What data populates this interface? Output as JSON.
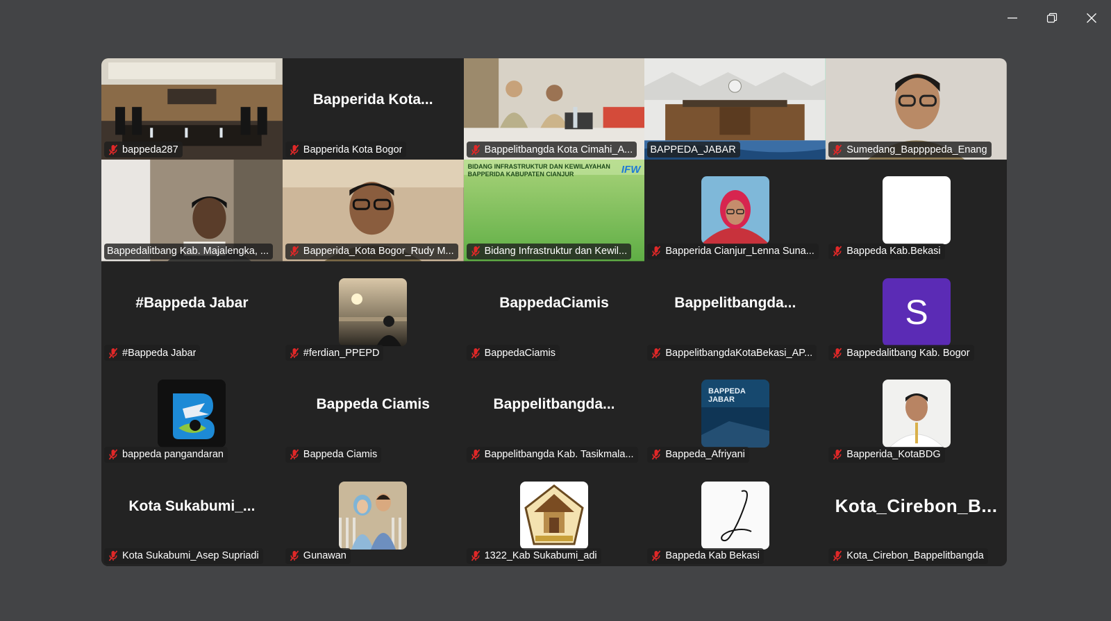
{
  "window": {
    "minimize_icon": "minimize-icon",
    "restore_icon": "restore-icon",
    "close_icon": "close-icon"
  },
  "colors": {
    "background": "#434446",
    "tile": "#232323",
    "active_border": "#23d98f",
    "muted_icon": "#e02828",
    "label_bg": "rgba(30,30,30,0.8)",
    "avatar_s": "#5b2bb5"
  },
  "participants": [
    {
      "name": "bappeda287",
      "kind": "video",
      "scene": "meeting-room"
    },
    {
      "name": "Bapperida Kota Bogor",
      "kind": "text",
      "big_name": "Bapperida  Kota..."
    },
    {
      "name": "Bappelitbangda Kota Cimahi_A...",
      "kind": "video",
      "scene": "office-desk"
    },
    {
      "name": "BAPPEDA_JABAR",
      "kind": "video",
      "scene": "stage",
      "active": true,
      "muted": false
    },
    {
      "name": "Sumedang_Bappppeda_Enang",
      "kind": "video",
      "scene": "person-glasses"
    },
    {
      "name": "Bappedalitbang Kab. Majalengka, ...",
      "kind": "video",
      "scene": "person-reading",
      "muted": false
    },
    {
      "name": "Bapperida_Kota Bogor_Rudy M...",
      "kind": "video",
      "scene": "person-glasses-2"
    },
    {
      "name": "Bidang Infrastruktur dan Kewil...",
      "kind": "video",
      "scene": "banner",
      "banner_line1": "BIDANG INFRASTRUKTUR DAN KEWILAYAHAN",
      "banner_line2": "BAPPERIDA KABUPATEN CIANJUR",
      "banner_logo": "IFW"
    },
    {
      "name": "Bapperida Cianjur_Lenna Suna...",
      "kind": "avatar",
      "avatar": "photo-hijab"
    },
    {
      "name": "Bappeda Kab.Bekasi",
      "kind": "avatar",
      "avatar": "white"
    },
    {
      "name": "#Bappeda Jabar",
      "kind": "text",
      "big_name": "#Bappeda Jabar"
    },
    {
      "name": "#ferdian_PPEPD",
      "kind": "avatar",
      "avatar": "photo-sunset"
    },
    {
      "name": "BappedaCiamis",
      "kind": "text",
      "big_name": "BappedaCiamis"
    },
    {
      "name": "BappelitbangdaKotaBekasi_AP...",
      "kind": "text",
      "big_name": "Bappelitbangda..."
    },
    {
      "name": "Bappedalitbang Kab. Bogor",
      "kind": "avatar",
      "avatar": "letter",
      "letter": "S"
    },
    {
      "name": "bappeda pangandaran",
      "kind": "avatar",
      "avatar": "logo-marlin"
    },
    {
      "name": "Bappeda Ciamis",
      "kind": "text",
      "big_name": "Bappeda Ciamis"
    },
    {
      "name": "Bappelitbangda Kab. Tasikmala...",
      "kind": "text",
      "big_name": "Bappelitbangda..."
    },
    {
      "name": "Bappeda_Afriyani",
      "kind": "avatar",
      "avatar": "book",
      "book_title": "BAPPEDA JABAR"
    },
    {
      "name": "Bapperida_KotaBDG",
      "kind": "avatar",
      "avatar": "photo-uniform"
    },
    {
      "name": "Kota Sukabumi_Asep Supriadi",
      "kind": "text",
      "big_name": "Kota  Sukabumi_..."
    },
    {
      "name": "Gunawan",
      "kind": "avatar",
      "avatar": "photo-couple"
    },
    {
      "name": "1322_Kab Sukabumi_adi",
      "kind": "avatar",
      "avatar": "logo-house"
    },
    {
      "name": "Bappeda Kab Bekasi",
      "kind": "avatar",
      "avatar": "signature"
    },
    {
      "name": "Kota_Cirebon_Bappelitbangda",
      "kind": "text",
      "big_name": "Kota_Cirebon_B...",
      "big": true
    }
  ]
}
